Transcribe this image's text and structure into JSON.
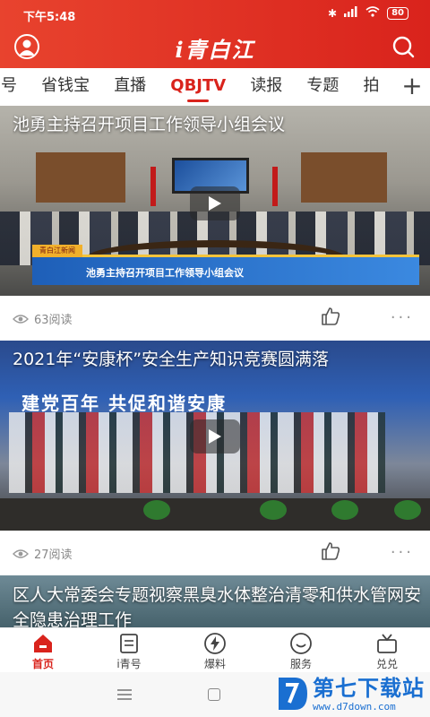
{
  "status": {
    "time": "下午5:48",
    "battery": "80"
  },
  "header": {
    "title": "i青白江"
  },
  "tabs": {
    "items": [
      "号",
      "省钱宝",
      "直播",
      "QBJTV",
      "读报",
      "专题",
      "拍"
    ],
    "active": "QBJTV",
    "plus": "+"
  },
  "feed": [
    {
      "title": "池勇主持召开项目工作领导小组会议",
      "lower_third": "池勇主持召开项目工作领导小组会议",
      "views": "63阅读"
    },
    {
      "title": "2021年“安康杯”安全生产知识竞赛圆满落",
      "banner": "建党百年  共促和谐安康",
      "views": "27阅读"
    },
    {
      "title": "区人大常委会专题视察黑臭水体整治清零和供水管网安全隐患治理工作"
    }
  ],
  "bottom_nav": {
    "items": [
      "首页",
      "i青号",
      "爆料",
      "服务",
      "兑兑"
    ],
    "active": "首页"
  },
  "watermark": {
    "name": "第七下载站",
    "url": "www.d7down.com"
  },
  "colors": {
    "brand": "#d9231c",
    "accent_blue": "#1a6fd1"
  }
}
